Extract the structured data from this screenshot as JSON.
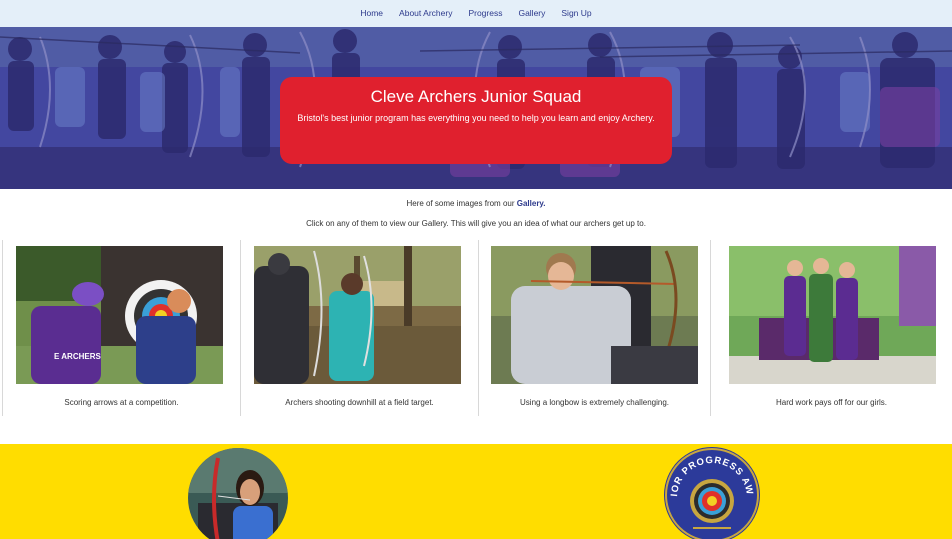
{
  "nav": {
    "items": [
      "Home",
      "About Archery",
      "Progress",
      "Gallery",
      "Sign Up"
    ]
  },
  "hero": {
    "title": "Cleve Archers Junior Squad",
    "subtitle": "Bristol's best junior program has everything you need to help you learn and enjoy Archery."
  },
  "intro": {
    "line1_prefix": "Here of some images from our",
    "line1_link": "Gallery.",
    "line2": "Click on any of them to view our Gallery. This will give you an idea of what our archers get up to."
  },
  "gallery": {
    "cards": [
      {
        "caption": "Scoring arrows at a competition."
      },
      {
        "caption": "Archers shooting downhill at a field target."
      },
      {
        "caption": "Using a longbow is extremely challenging."
      },
      {
        "caption": "Hard work pays off for our girls."
      }
    ]
  },
  "badge": {
    "text_top": "JUNIOR PROGRESS AWARD"
  },
  "colors": {
    "nav_bg": "#e4eff9",
    "hero_box": "#e0202e",
    "yellow": "#ffdd00",
    "link": "#2d3a8c"
  }
}
